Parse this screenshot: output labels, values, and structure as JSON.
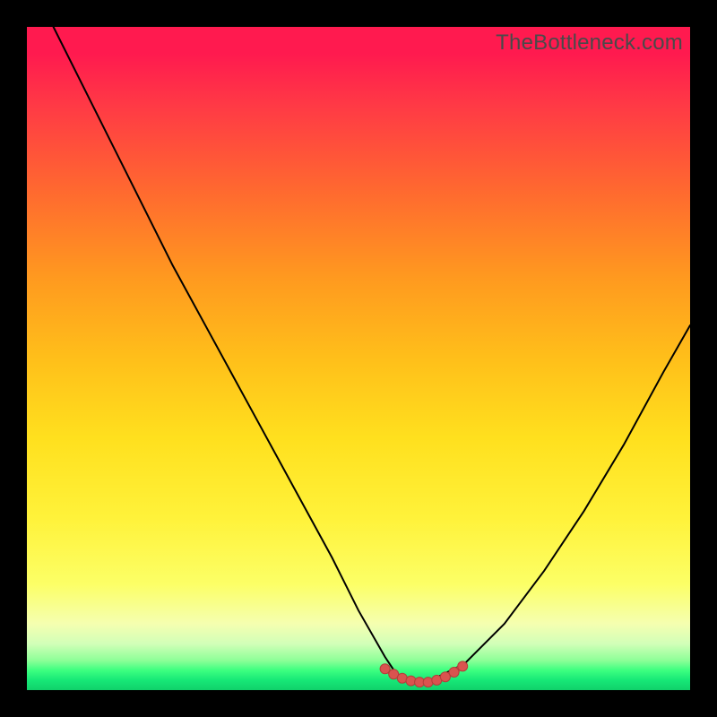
{
  "watermark": "TheBottleneck.com",
  "colors": {
    "frame": "#000000",
    "curve": "#000000",
    "marker_fill": "#d9534f",
    "marker_stroke": "#b23e3a"
  },
  "chart_data": {
    "type": "line",
    "title": "",
    "xlabel": "",
    "ylabel": "",
    "xlim": [
      0,
      100
    ],
    "ylim": [
      0,
      100
    ],
    "grid": false,
    "legend": false,
    "series": [
      {
        "name": "bottleneck-curve",
        "x": [
          4,
          10,
          16,
          22,
          28,
          34,
          40,
          46,
          50,
          54,
          56,
          58,
          60,
          62,
          66,
          72,
          78,
          84,
          90,
          96,
          100
        ],
        "y": [
          100,
          88,
          76,
          64,
          53,
          42,
          31,
          20,
          12,
          5,
          2,
          1,
          1,
          2,
          4,
          10,
          18,
          27,
          37,
          48,
          55
        ]
      }
    ],
    "annotations": {
      "valley_markers": {
        "description": "highlighted dots along the valley minimum",
        "x": [
          54.0,
          55.3,
          56.6,
          57.9,
          59.2,
          60.5,
          61.8,
          63.1,
          64.4,
          65.7
        ],
        "y": [
          3.2,
          2.4,
          1.8,
          1.4,
          1.2,
          1.2,
          1.5,
          2.0,
          2.7,
          3.6
        ]
      }
    }
  }
}
